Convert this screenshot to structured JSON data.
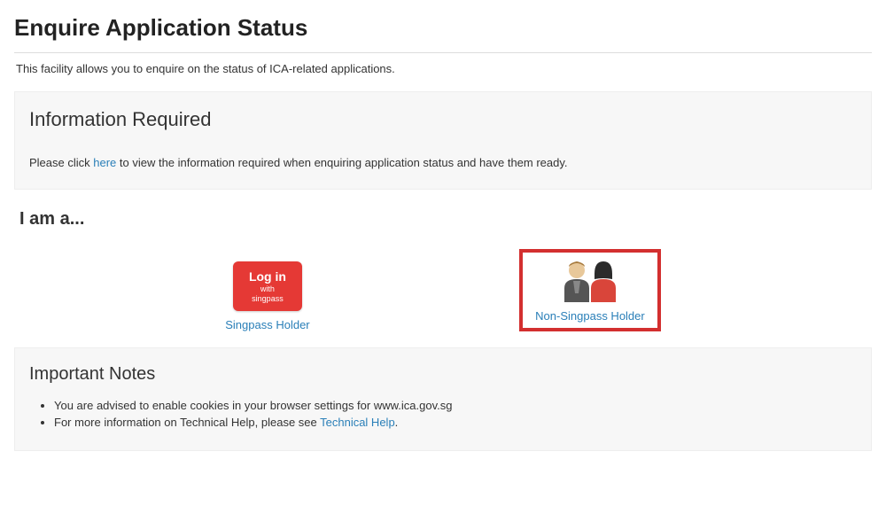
{
  "page": {
    "title": "Enquire Application Status",
    "intro": "This facility allows you to enquire on the status of ICA-related applications."
  },
  "info_panel": {
    "title": "Information Required",
    "text_before": "Please click ",
    "link_text": "here",
    "text_after": " to view the information required when enquiring application status and have them ready."
  },
  "selector": {
    "heading": "I am a...",
    "singpass_btn_line1": "Log in",
    "singpass_btn_line2": "with singpass",
    "singpass_label": "Singpass Holder",
    "nonsingpass_label": "Non-Singpass Holder"
  },
  "notes": {
    "title": "Important Notes",
    "item1": "You are advised to enable cookies in your browser settings for www.ica.gov.sg",
    "item2_before": "For more information on Technical Help, please see ",
    "item2_link": "Technical Help",
    "item2_after": "."
  }
}
